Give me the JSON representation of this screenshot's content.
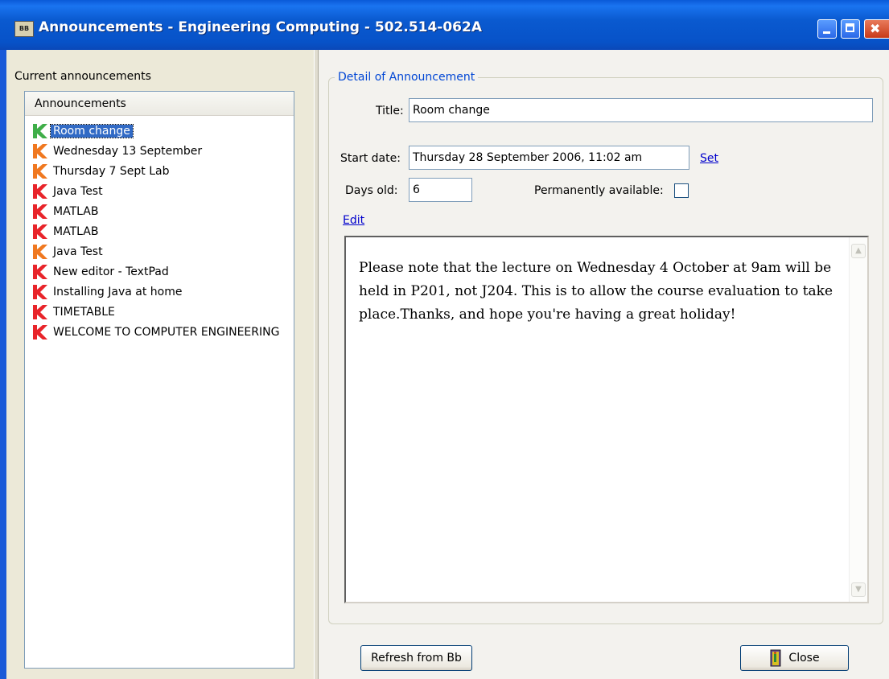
{
  "window": {
    "title": "Announcements - Engineering Computing - 502.514-062A",
    "icon": "app-icon",
    "icon_text": "BB"
  },
  "left": {
    "label": "Current announcements",
    "list_header": "Announcements",
    "items": [
      {
        "label": "Room change",
        "color": "#3fae49",
        "selected": true
      },
      {
        "label": "Wednesday 13 September",
        "color": "#f07820"
      },
      {
        "label": "Thursday 7 Sept Lab",
        "color": "#f07820"
      },
      {
        "label": "Java Test",
        "color": "#e8242a"
      },
      {
        "label": "MATLAB",
        "color": "#e8242a"
      },
      {
        "label": "MATLAB",
        "color": "#e8242a"
      },
      {
        "label": "Java Test",
        "color": "#f07820"
      },
      {
        "label": "New editor - TextPad",
        "color": "#e8242a"
      },
      {
        "label": "Installing Java at home",
        "color": "#e8242a"
      },
      {
        "label": "TIMETABLE",
        "color": "#e8242a"
      },
      {
        "label": "WELCOME TO COMPUTER ENGINEERING",
        "color": "#e8242a"
      }
    ]
  },
  "detail": {
    "group_title": "Detail of Announcement",
    "title_label": "Title:",
    "title_value": "Room change",
    "start_label": "Start date:",
    "start_value": "Thursday 28 September 2006, 11:02 am",
    "set_link": "Set",
    "days_label": "Days old:",
    "days_value": "6",
    "perm_label": "Permanently available:",
    "perm_checked": false,
    "edit_link": "Edit",
    "body": "Please note that the lecture on Wednesday 4 October at 9am will be held in P201, not J204. This is to allow the course evaluation to take place.Thanks, and hope you're having a great holiday!"
  },
  "buttons": {
    "refresh": "Refresh from Bb",
    "close": "Close"
  }
}
